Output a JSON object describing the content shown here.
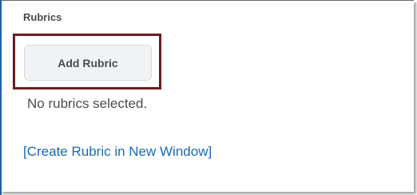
{
  "section": {
    "title": "Rubrics"
  },
  "buttons": {
    "add_rubric": "Add Rubric"
  },
  "status": {
    "empty_message": "No rubrics selected."
  },
  "links": {
    "create_rubric": "[Create Rubric in New Window]"
  },
  "colors": {
    "highlight": "#6e1b20",
    "link": "#1a6ab3",
    "text": "#494c4e"
  }
}
